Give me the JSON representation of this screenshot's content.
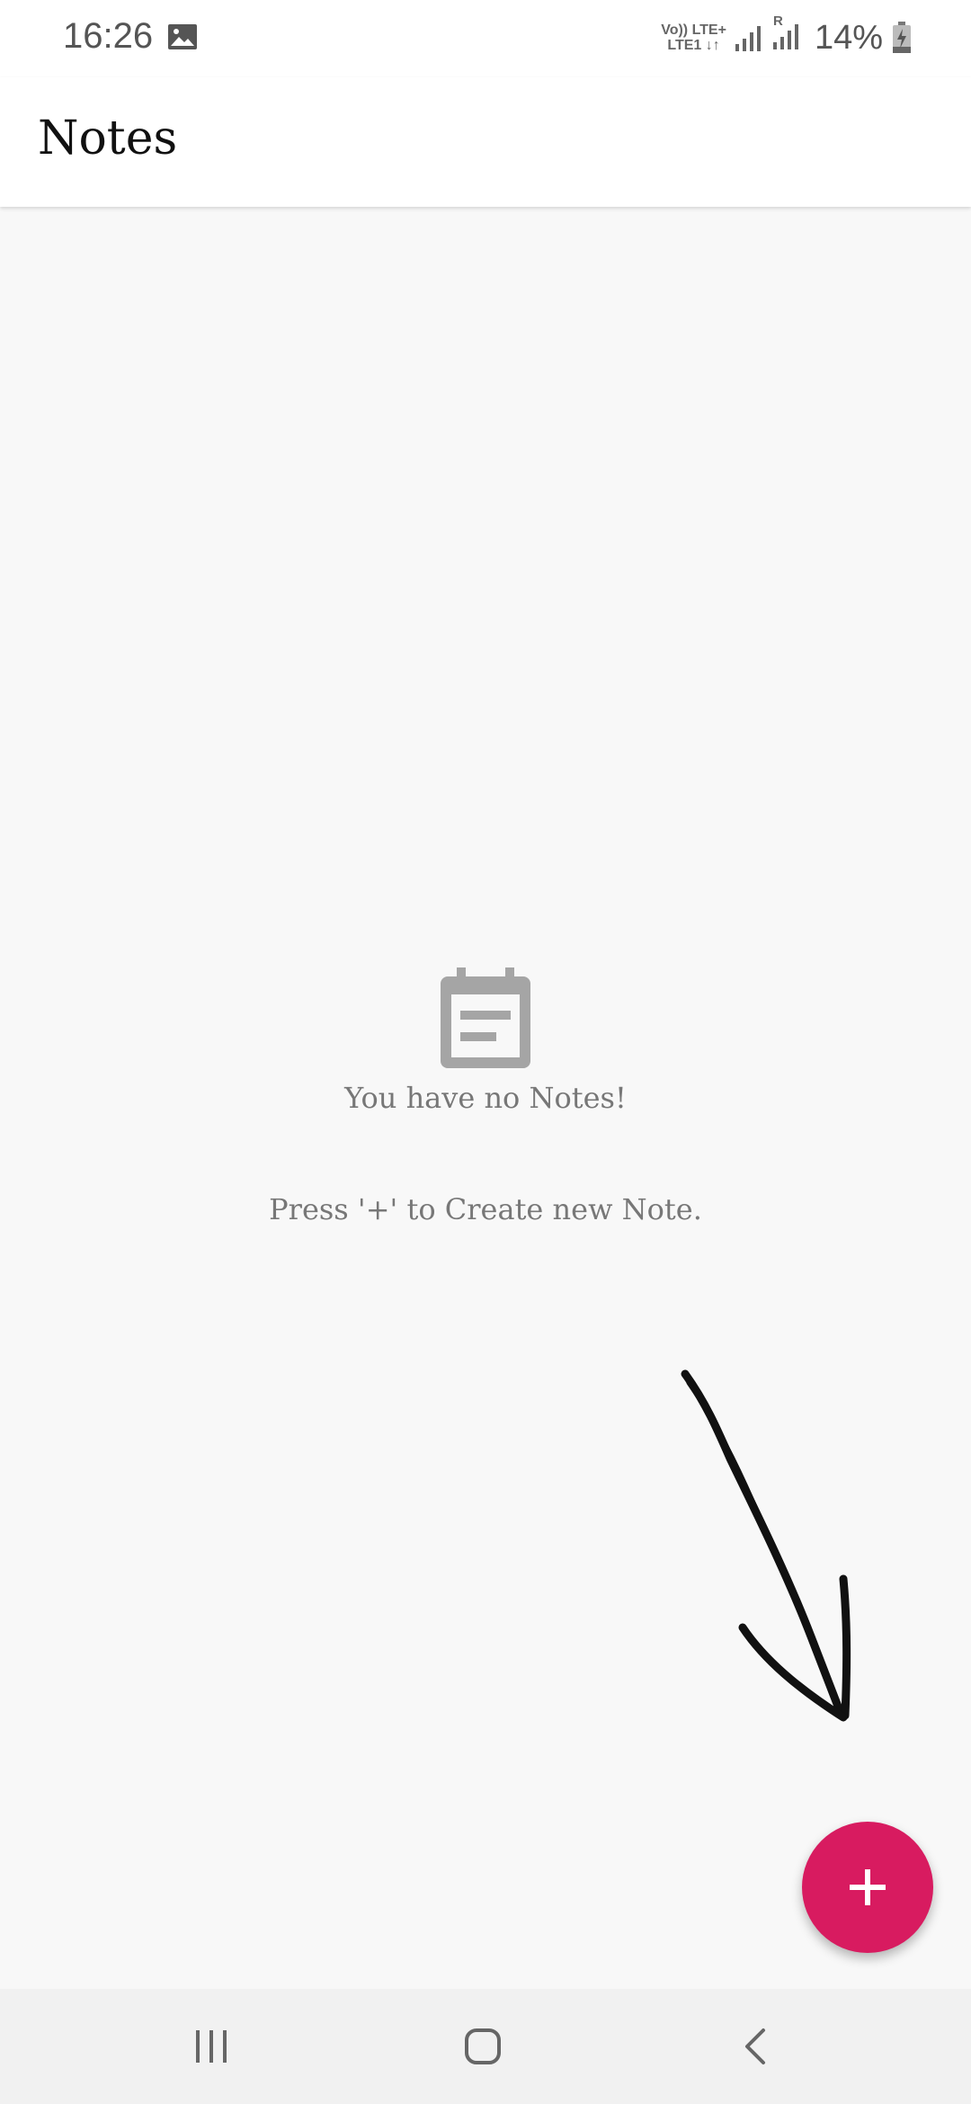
{
  "status_bar": {
    "time": "16:26",
    "network_line1": "Vo)) LTE+",
    "network_line2": "LTE1 ↓↑",
    "roaming_label": "R",
    "battery": "14%",
    "icons": [
      "gallery-icon",
      "signal-icon",
      "roaming-signal-icon",
      "battery-charging-icon"
    ]
  },
  "app_bar": {
    "title": "Notes"
  },
  "empty_state": {
    "icon": "note-icon",
    "title": "You have no Notes!",
    "hint": "Press '+' to Create new Note."
  },
  "fab": {
    "icon": "add-icon",
    "color": "#d81b60"
  },
  "annotation": {
    "icon": "hand-drawn-arrow-icon",
    "color": "#111111"
  },
  "nav_bar": {
    "buttons": [
      "recents-icon",
      "home-icon",
      "back-icon"
    ]
  },
  "colors": {
    "background": "#f8f8f8",
    "app_bar": "#ffffff",
    "text_primary": "#111111",
    "text_secondary": "#777777",
    "accent": "#d81b60",
    "nav_bar": "#f1f1f1"
  }
}
